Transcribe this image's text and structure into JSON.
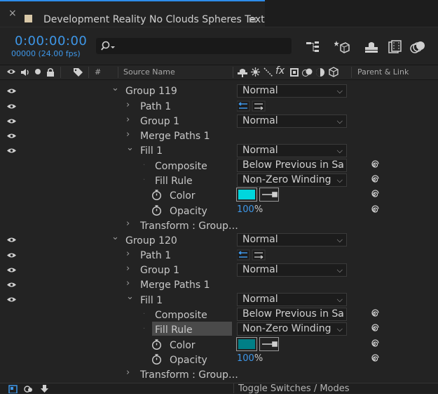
{
  "tab": {
    "close": "×",
    "title": "Development Reality No Clouds Spheres Text",
    "menu": "≡"
  },
  "time": {
    "timecode": "0:00:00:00",
    "frames": "00000 (24.00 fps)"
  },
  "search": {
    "placeholder": ""
  },
  "columns": {
    "source_name": "Source Name",
    "number": "#",
    "parent_link": "Parent & Link",
    "switch_icons": "fx"
  },
  "mode_label": "Toggle Switches / Modes",
  "colors": {
    "accent": "#2d8ceb",
    "timecode": "#3e97e8",
    "fill_119": "#00d6dd",
    "fill_120": "#007f86"
  },
  "rows": [
    {
      "label": "Group 119",
      "chev": "⌄",
      "value": "Normal"
    },
    {
      "label": "Path 1",
      "chev": "›"
    },
    {
      "label": "Group 1",
      "chev": "›",
      "value": "Normal"
    },
    {
      "label": "Merge Paths 1",
      "chev": "›"
    },
    {
      "label": "Fill 1",
      "chev": "⌄",
      "value": "Normal"
    },
    {
      "label": "Composite",
      "value": "Below Previous in Sa"
    },
    {
      "label": "Fill Rule",
      "value": "Non-Zero Winding"
    },
    {
      "label": "Color"
    },
    {
      "label": "Opacity",
      "number": "100",
      "unit": "%"
    },
    {
      "label": "Transform : Group…",
      "chev": "›"
    },
    {
      "label": "Group 120",
      "chev": "⌄",
      "value": "Normal"
    },
    {
      "label": "Path 1",
      "chev": "›"
    },
    {
      "label": "Group 1",
      "chev": "›",
      "value": "Normal"
    },
    {
      "label": "Merge Paths 1",
      "chev": "›"
    },
    {
      "label": "Fill 1",
      "chev": "⌄",
      "value": "Normal"
    },
    {
      "label": "Composite",
      "value": "Below Previous in Sa"
    },
    {
      "label": "Fill Rule",
      "value": "Non-Zero Winding"
    },
    {
      "label": "Color"
    },
    {
      "label": "Opacity",
      "number": "100",
      "unit": "%"
    },
    {
      "label": "Transform : Group…",
      "chev": "›"
    }
  ]
}
